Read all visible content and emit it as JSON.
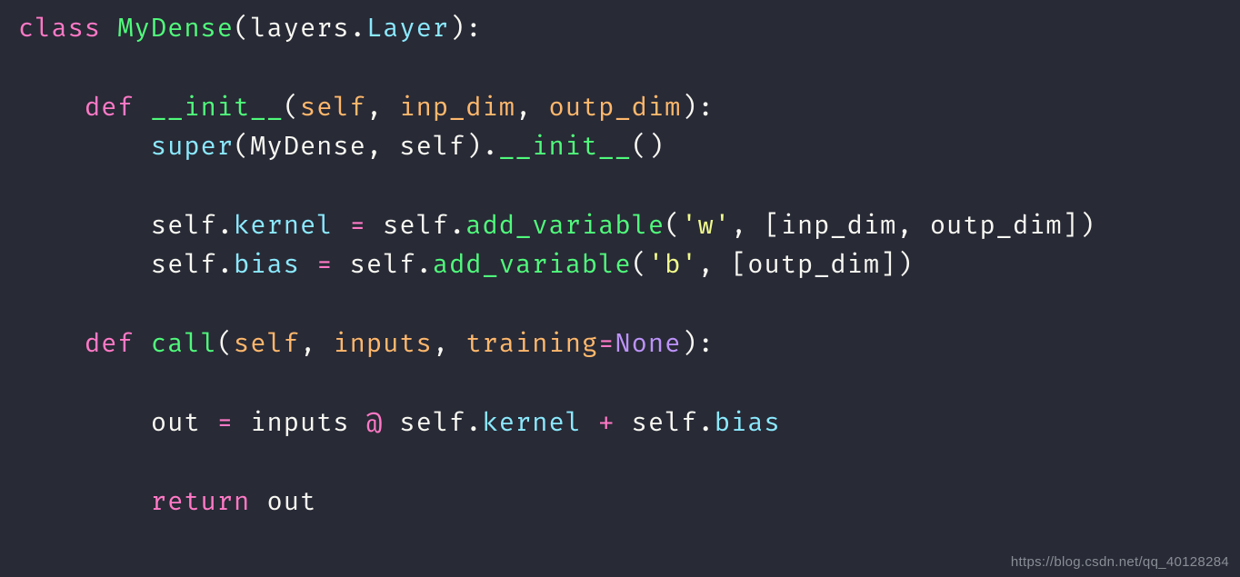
{
  "code": {
    "lines": [
      [
        {
          "cls": "kw",
          "t": "class "
        },
        {
          "cls": "cls",
          "t": "MyDense"
        },
        {
          "cls": "punc",
          "t": "("
        },
        {
          "cls": "id",
          "t": "layers"
        },
        {
          "cls": "punc",
          "t": "."
        },
        {
          "cls": "attr",
          "t": "Layer"
        },
        {
          "cls": "punc",
          "t": "):"
        }
      ],
      [],
      [
        {
          "cls": "",
          "t": "    "
        },
        {
          "cls": "kw",
          "t": "def "
        },
        {
          "cls": "fn",
          "t": "__init__"
        },
        {
          "cls": "punc",
          "t": "("
        },
        {
          "cls": "param",
          "t": "self"
        },
        {
          "cls": "punc",
          "t": ", "
        },
        {
          "cls": "param",
          "t": "inp_dim"
        },
        {
          "cls": "punc",
          "t": ", "
        },
        {
          "cls": "param",
          "t": "outp_dim"
        },
        {
          "cls": "punc",
          "t": "):"
        }
      ],
      [
        {
          "cls": "",
          "t": "        "
        },
        {
          "cls": "builtin",
          "t": "super"
        },
        {
          "cls": "punc",
          "t": "("
        },
        {
          "cls": "id",
          "t": "MyDense"
        },
        {
          "cls": "punc",
          "t": ", "
        },
        {
          "cls": "id",
          "t": "self"
        },
        {
          "cls": "punc",
          "t": ")."
        },
        {
          "cls": "call",
          "t": "__init__"
        },
        {
          "cls": "punc",
          "t": "()"
        }
      ],
      [],
      [
        {
          "cls": "",
          "t": "        "
        },
        {
          "cls": "id",
          "t": "self"
        },
        {
          "cls": "punc",
          "t": "."
        },
        {
          "cls": "attr",
          "t": "kernel"
        },
        {
          "cls": "punc",
          "t": " "
        },
        {
          "cls": "op",
          "t": "="
        },
        {
          "cls": "punc",
          "t": " "
        },
        {
          "cls": "id",
          "t": "self"
        },
        {
          "cls": "punc",
          "t": "."
        },
        {
          "cls": "call",
          "t": "add_variable"
        },
        {
          "cls": "punc",
          "t": "("
        },
        {
          "cls": "str",
          "t": "'w'"
        },
        {
          "cls": "punc",
          "t": ", ["
        },
        {
          "cls": "id",
          "t": "inp_dim"
        },
        {
          "cls": "punc",
          "t": ", "
        },
        {
          "cls": "id",
          "t": "outp_dim"
        },
        {
          "cls": "punc",
          "t": "])"
        }
      ],
      [
        {
          "cls": "",
          "t": "        "
        },
        {
          "cls": "id",
          "t": "self"
        },
        {
          "cls": "punc",
          "t": "."
        },
        {
          "cls": "attr",
          "t": "bias"
        },
        {
          "cls": "punc",
          "t": " "
        },
        {
          "cls": "op",
          "t": "="
        },
        {
          "cls": "punc",
          "t": " "
        },
        {
          "cls": "id",
          "t": "self"
        },
        {
          "cls": "punc",
          "t": "."
        },
        {
          "cls": "call",
          "t": "add_variable"
        },
        {
          "cls": "punc",
          "t": "("
        },
        {
          "cls": "str",
          "t": "'b'"
        },
        {
          "cls": "punc",
          "t": ", ["
        },
        {
          "cls": "id",
          "t": "outp_dim"
        },
        {
          "cls": "punc",
          "t": "])"
        }
      ],
      [],
      [
        {
          "cls": "",
          "t": "    "
        },
        {
          "cls": "kw",
          "t": "def "
        },
        {
          "cls": "fn",
          "t": "call"
        },
        {
          "cls": "punc",
          "t": "("
        },
        {
          "cls": "param",
          "t": "self"
        },
        {
          "cls": "punc",
          "t": ", "
        },
        {
          "cls": "param",
          "t": "inputs"
        },
        {
          "cls": "punc",
          "t": ", "
        },
        {
          "cls": "param",
          "t": "training"
        },
        {
          "cls": "op",
          "t": "="
        },
        {
          "cls": "const",
          "t": "None"
        },
        {
          "cls": "punc",
          "t": "):"
        }
      ],
      [],
      [
        {
          "cls": "",
          "t": "        "
        },
        {
          "cls": "id",
          "t": "out"
        },
        {
          "cls": "punc",
          "t": " "
        },
        {
          "cls": "op",
          "t": "="
        },
        {
          "cls": "punc",
          "t": " "
        },
        {
          "cls": "id",
          "t": "inputs"
        },
        {
          "cls": "punc",
          "t": " "
        },
        {
          "cls": "op",
          "t": "@"
        },
        {
          "cls": "punc",
          "t": " "
        },
        {
          "cls": "id",
          "t": "self"
        },
        {
          "cls": "punc",
          "t": "."
        },
        {
          "cls": "attr",
          "t": "kernel"
        },
        {
          "cls": "punc",
          "t": " "
        },
        {
          "cls": "op",
          "t": "+"
        },
        {
          "cls": "punc",
          "t": " "
        },
        {
          "cls": "id",
          "t": "self"
        },
        {
          "cls": "punc",
          "t": "."
        },
        {
          "cls": "attr",
          "t": "bias"
        }
      ],
      [],
      [
        {
          "cls": "",
          "t": "        "
        },
        {
          "cls": "kw",
          "t": "return"
        },
        {
          "cls": "punc",
          "t": " "
        },
        {
          "cls": "id",
          "t": "out"
        }
      ]
    ]
  },
  "watermark": "https://blog.csdn.net/qq_40128284"
}
